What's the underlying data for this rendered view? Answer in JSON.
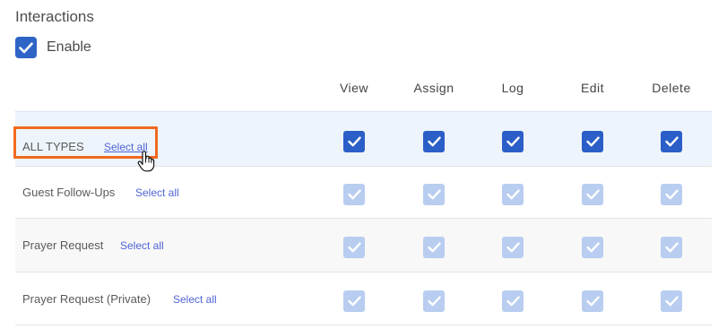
{
  "section": {
    "title": "Interactions"
  },
  "enable": {
    "label": "Enable",
    "checked": true
  },
  "columns": [
    "View",
    "Assign",
    "Log",
    "Edit",
    "Delete"
  ],
  "rows": [
    {
      "label": "ALL TYPES",
      "select_all": "Select all",
      "checked": [
        true,
        true,
        true,
        true,
        true
      ],
      "state": "active"
    },
    {
      "label": "Guest Follow-Ups",
      "select_all": "Select all",
      "checked": [
        true,
        true,
        true,
        true,
        true
      ],
      "state": "inherited"
    },
    {
      "label": "Prayer Request",
      "select_all": "Select all",
      "checked": [
        true,
        true,
        true,
        true,
        true
      ],
      "state": "inherited"
    },
    {
      "label": "Prayer Request (Private)",
      "select_all": "Select all",
      "checked": [
        true,
        true,
        true,
        true,
        true
      ],
      "state": "inherited"
    }
  ],
  "colors": {
    "checkbox_active": "#2b5fc7",
    "checkbox_inherited": "#b8cdf0",
    "highlight_box": "#ef6a1e",
    "link": "#4f64d6"
  },
  "icons": {
    "checkmark": "check-icon",
    "cursor": "hand-pointer-icon"
  }
}
